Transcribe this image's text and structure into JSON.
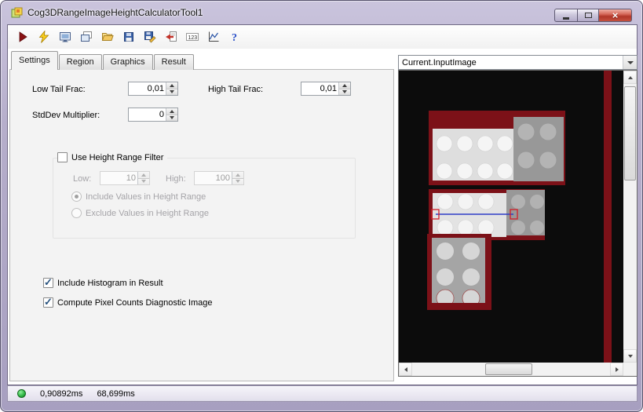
{
  "window": {
    "title": "Cog3DRangeImageHeightCalculatorTool1"
  },
  "toolbar": {
    "icons": [
      "run",
      "electric-runs",
      "show-image",
      "show-diagnostic-image",
      "open",
      "save",
      "save-as",
      "import",
      "pixel-counts",
      "plot",
      "help"
    ]
  },
  "tabs": {
    "settings": "Settings",
    "region": "Region",
    "graphics": "Graphics",
    "result": "Result"
  },
  "settings": {
    "low_tail_frac_label": "Low Tail Frac:",
    "low_tail_frac_value": "0,01",
    "high_tail_frac_label": "High Tail Frac:",
    "high_tail_frac_value": "0,01",
    "stddev_multiplier_label": "StdDev Multiplier:",
    "stddev_multiplier_value": "0",
    "use_height_range_filter_label": "Use Height Range Filter",
    "use_height_range_filter_checked": false,
    "low_label": "Low:",
    "low_value": "10",
    "high_label": "High:",
    "high_value": "100",
    "include_values_label": "Include Values in Height Range",
    "include_values_selected": true,
    "exclude_values_label": "Exclude Values in Height Range",
    "exclude_values_selected": false,
    "include_histogram_label": "Include Histogram in Result",
    "include_histogram_checked": true,
    "compute_pixel_counts_label": "Compute Pixel Counts Diagnostic Image",
    "compute_pixel_counts_checked": true
  },
  "image_panel": {
    "source_selector_value": "Current.InputImage"
  },
  "status_bar": {
    "execution_time": "0,90892ms",
    "total_time": "68,699ms"
  },
  "colors": {
    "frame": "#b6aecb",
    "maroon": "#7c1118",
    "roi_blue": "#2e3cc8",
    "roi_handle_red": "#d21f28",
    "status_led_green": "#2eb343"
  }
}
